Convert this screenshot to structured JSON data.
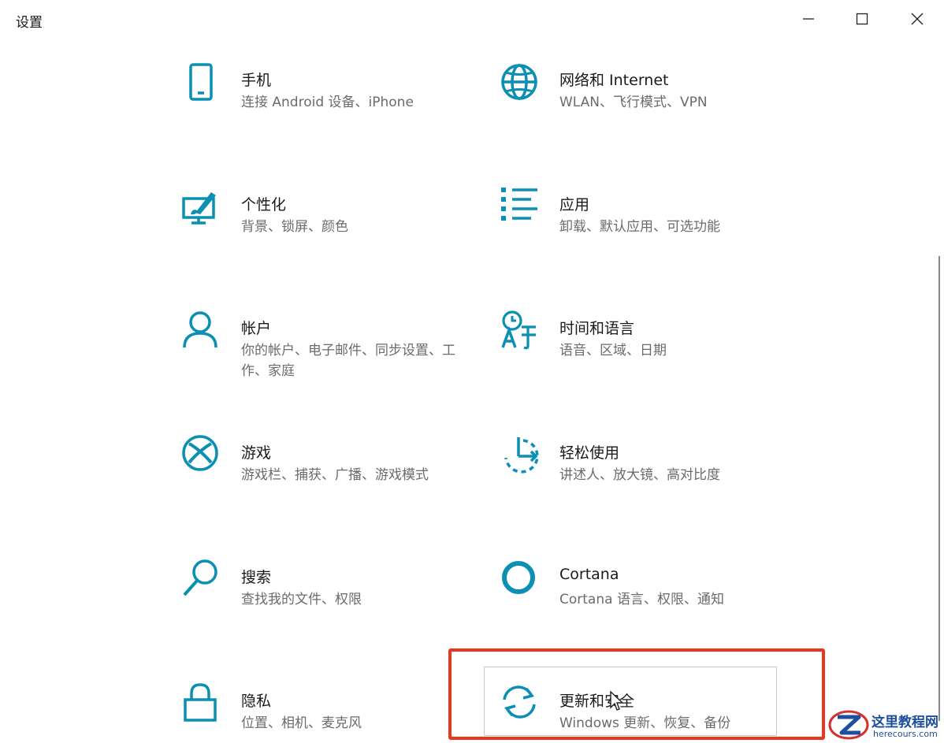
{
  "window": {
    "title": "设置"
  },
  "tiles": [
    {
      "id": "phone",
      "title": "手机",
      "desc": "连接 Android 设备、iPhone",
      "icon": "phone-icon"
    },
    {
      "id": "network",
      "title": "网络和 Internet",
      "desc": "WLAN、飞行模式、VPN",
      "icon": "globe-icon"
    },
    {
      "id": "personalization",
      "title": "个性化",
      "desc": "背景、锁屏、颜色",
      "icon": "personalization-icon"
    },
    {
      "id": "apps",
      "title": "应用",
      "desc": "卸载、默认应用、可选功能",
      "icon": "apps-list-icon"
    },
    {
      "id": "accounts",
      "title": "帐户",
      "desc": "你的帐户、电子邮件、同步设置、工作、家庭",
      "icon": "person-icon"
    },
    {
      "id": "time-language",
      "title": "时间和语言",
      "desc": "语音、区域、日期",
      "icon": "time-language-icon"
    },
    {
      "id": "gaming",
      "title": "游戏",
      "desc": "游戏栏、捕获、广播、游戏模式",
      "icon": "xbox-icon"
    },
    {
      "id": "ease-of-access",
      "title": "轻松使用",
      "desc": "讲述人、放大镜、高对比度",
      "icon": "ease-of-access-icon"
    },
    {
      "id": "search",
      "title": "搜索",
      "desc": "查找我的文件、权限",
      "icon": "search-icon"
    },
    {
      "id": "cortana",
      "title": "Cortana",
      "desc": "Cortana 语言、权限、通知",
      "icon": "cortana-icon"
    },
    {
      "id": "privacy",
      "title": "隐私",
      "desc": "位置、相机、麦克风",
      "icon": "lock-icon"
    },
    {
      "id": "update-security",
      "title": "更新和安全",
      "desc": "Windows 更新、恢复、备份",
      "icon": "sync-icon"
    }
  ],
  "colors": {
    "accent": "#0b8fb3",
    "highlight_border": "#e8361f"
  },
  "watermark": {
    "name": "这里教程网",
    "url": "herecours.com"
  }
}
